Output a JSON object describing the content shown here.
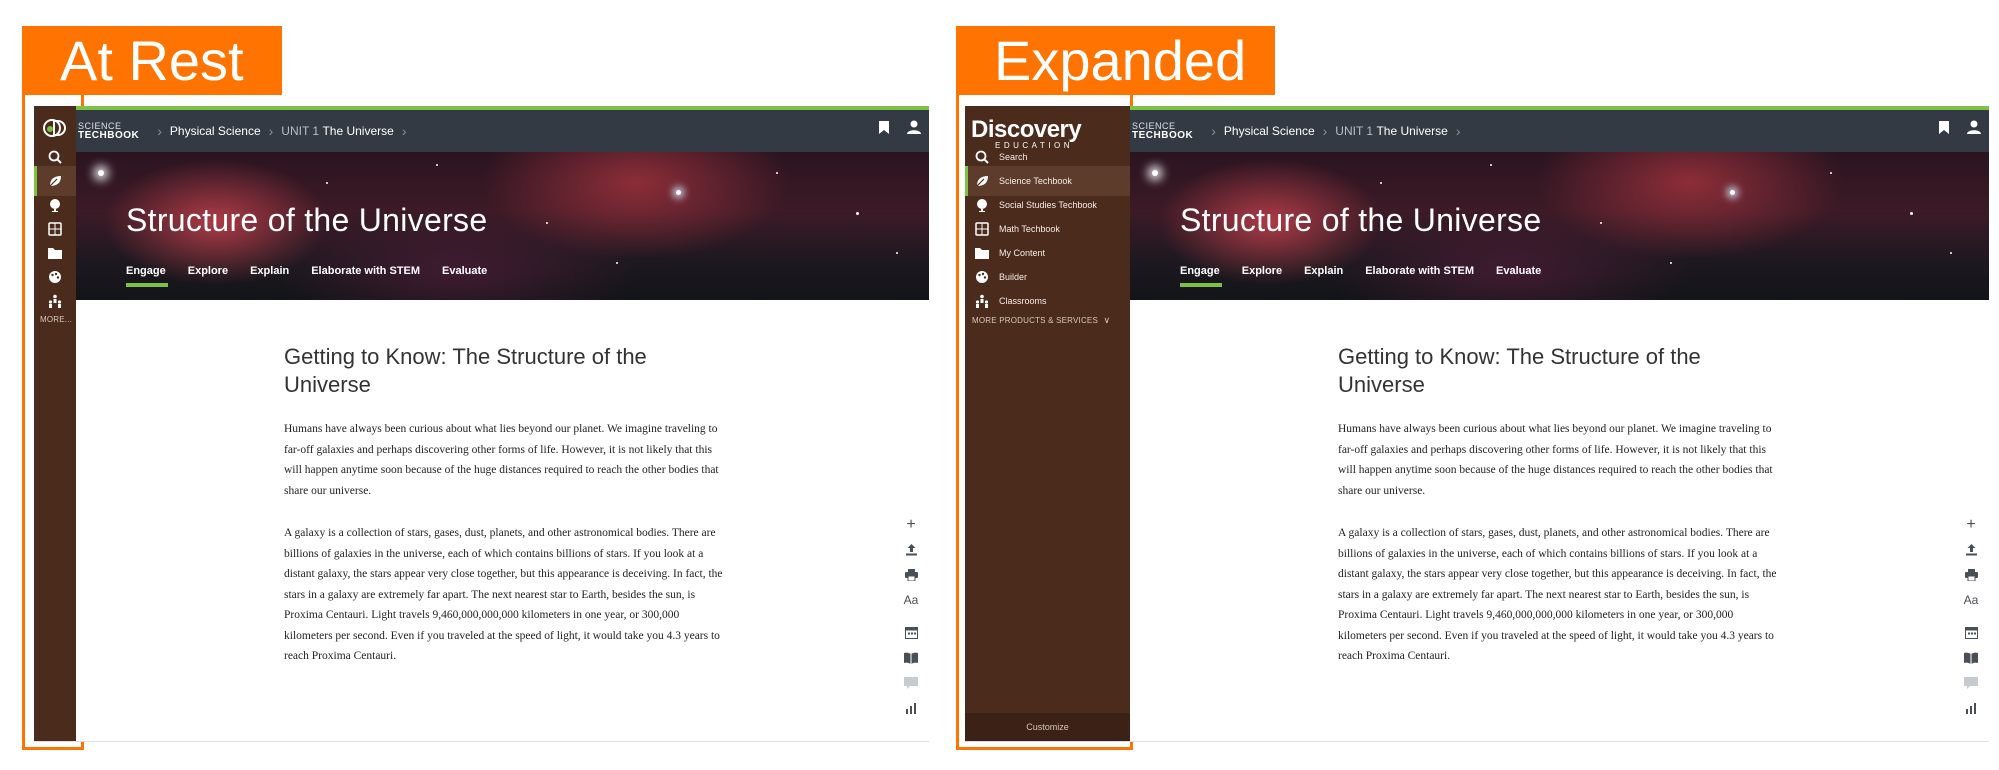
{
  "labels": {
    "rest": "At Rest",
    "expanded": "Expanded"
  },
  "colors": {
    "accent": "#ff7400",
    "sidebar": "#4a2b1c",
    "topbar": "#343a44",
    "active_underline": "#7dc242"
  },
  "topbar": {
    "brand_top": "SCIENCE",
    "brand_bottom": "TECHBOOK",
    "crumb1": "Physical Science",
    "unit_label": "UNIT 1",
    "unit_name": "The Universe",
    "icons": [
      "bookmark-icon",
      "user-icon"
    ]
  },
  "hero": {
    "title": "Structure of the Universe",
    "tabs": [
      "Engage",
      "Explore",
      "Explain",
      "Elaborate with STEM",
      "Evaluate"
    ],
    "active_tab": "Engage"
  },
  "article": {
    "heading": "Getting to Know: The Structure of the Universe",
    "p1": "Humans have always been curious about what lies beyond our planet. We imagine traveling to far-off galaxies and perhaps discovering other forms of life. However, it is not likely that this will happen anytime soon because of the huge distances required to reach the other bodies that share our universe.",
    "p2": "A galaxy is a collection of stars, gases, dust, planets, and other astronomical bodies. There are billions of galaxies in the universe, each of which contains billions of stars. If you look at a distant galaxy, the stars appear very close together, but this appearance is deceiving. In fact, the stars in a galaxy are extremely far apart. The next nearest star to Earth, besides the sun, is Proxima Centauri. Light travels 9,460,000,000,000 kilometers in one year, or 300,000 kilometers per second. Even if you traveled at the speed of light, it would take you 4.3 years to reach Proxima Centauri."
  },
  "tools": {
    "aa": "Aa",
    "icons": [
      "plus-icon",
      "upload-icon",
      "print-icon",
      "text-size-icon",
      "calendar-icon",
      "book-icon",
      "comment-icon",
      "chart-icon"
    ]
  },
  "sidebar": {
    "logo_word": "Discovery",
    "logo_sub": "EDUCATION",
    "items": [
      {
        "label": "Search",
        "icon": "search-icon"
      },
      {
        "label": "Science Techbook",
        "icon": "leaf-icon"
      },
      {
        "label": "Social Studies Techbook",
        "icon": "globe-icon"
      },
      {
        "label": "Math Techbook",
        "icon": "calculator-icon"
      },
      {
        "label": "My Content",
        "icon": "folder-icon"
      },
      {
        "label": "Builder",
        "icon": "palette-icon"
      },
      {
        "label": "Classrooms",
        "icon": "classroom-icon"
      }
    ],
    "more_short": "MORE...",
    "more_long": "MORE PRODUCTS & SERVICES",
    "customize": "Customize"
  }
}
